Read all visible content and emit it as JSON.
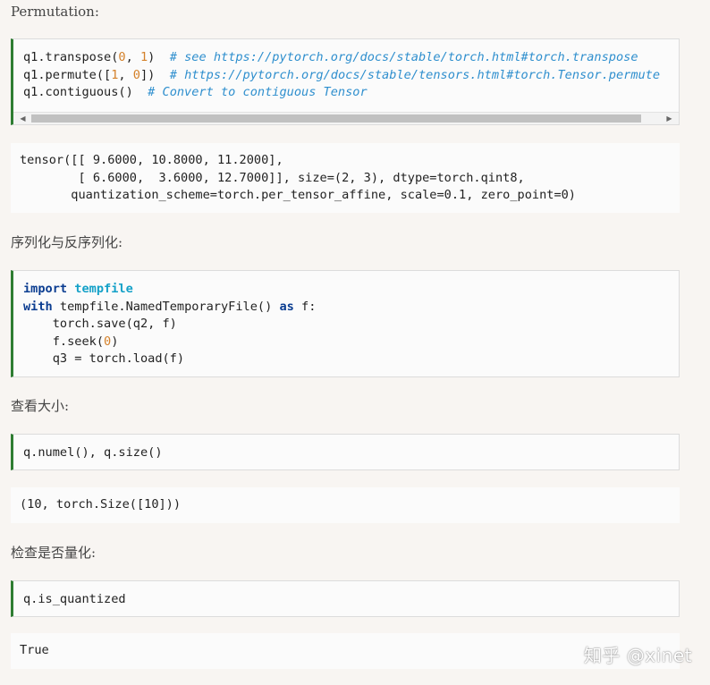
{
  "headings": {
    "permutation": "Permutation:",
    "serialization": "序列化与反序列化:",
    "size": "查看大小:",
    "quantized": "检查是否量化:"
  },
  "cells": {
    "permute_code": {
      "line1": {
        "a": "q1.transpose(",
        "n1": "0",
        "b": ", ",
        "n2": "1",
        "c": ")  ",
        "comment": "# see https://pytorch.org/docs/stable/torch.html#torch.transpose"
      },
      "line2": {
        "a": "q1.permute([",
        "n1": "1",
        "b": ", ",
        "n2": "0",
        "c": "])  ",
        "comment": "# https://pytorch.org/docs/stable/tensors.html#torch.Tensor.permute"
      },
      "line3": {
        "a": "q1.contiguous()  ",
        "comment": "# Convert to contiguous Tensor"
      }
    },
    "permute_output": "tensor([[ 9.6000, 10.8000, 11.2000],\n        [ 6.6000,  3.6000, 12.7000]], size=(2, 3), dtype=torch.qint8,\n       quantization_scheme=torch.per_tensor_affine, scale=0.1, zero_point=0)",
    "serial_code": {
      "kw_import": "import",
      "mod_tempfile": "tempfile",
      "kw_with": "with",
      "with_rest": " tempfile.NamedTemporaryFile() ",
      "kw_as": "as",
      "as_rest": " f:",
      "line3": "    torch.save(q2, f)",
      "line4_a": "    f.seek(",
      "line4_n": "0",
      "line4_b": ")",
      "line5": "    q3 = torch.load(f)"
    },
    "size_code": "q.numel(), q.size()",
    "size_output": "(10, torch.Size([10]))",
    "quant_code": "q.is_quantized",
    "quant_output": "True"
  },
  "scrollbar": {
    "left_arrow": "◀",
    "right_arrow": "▶"
  },
  "watermark": "知乎 @xinet",
  "colors": {
    "page_bg": "#f8f5f2",
    "cell_border_accent": "#2e7d32",
    "keyword": "#0b3d91",
    "module": "#14a1c8",
    "number": "#d4812a",
    "comment": "#2f8fce"
  }
}
